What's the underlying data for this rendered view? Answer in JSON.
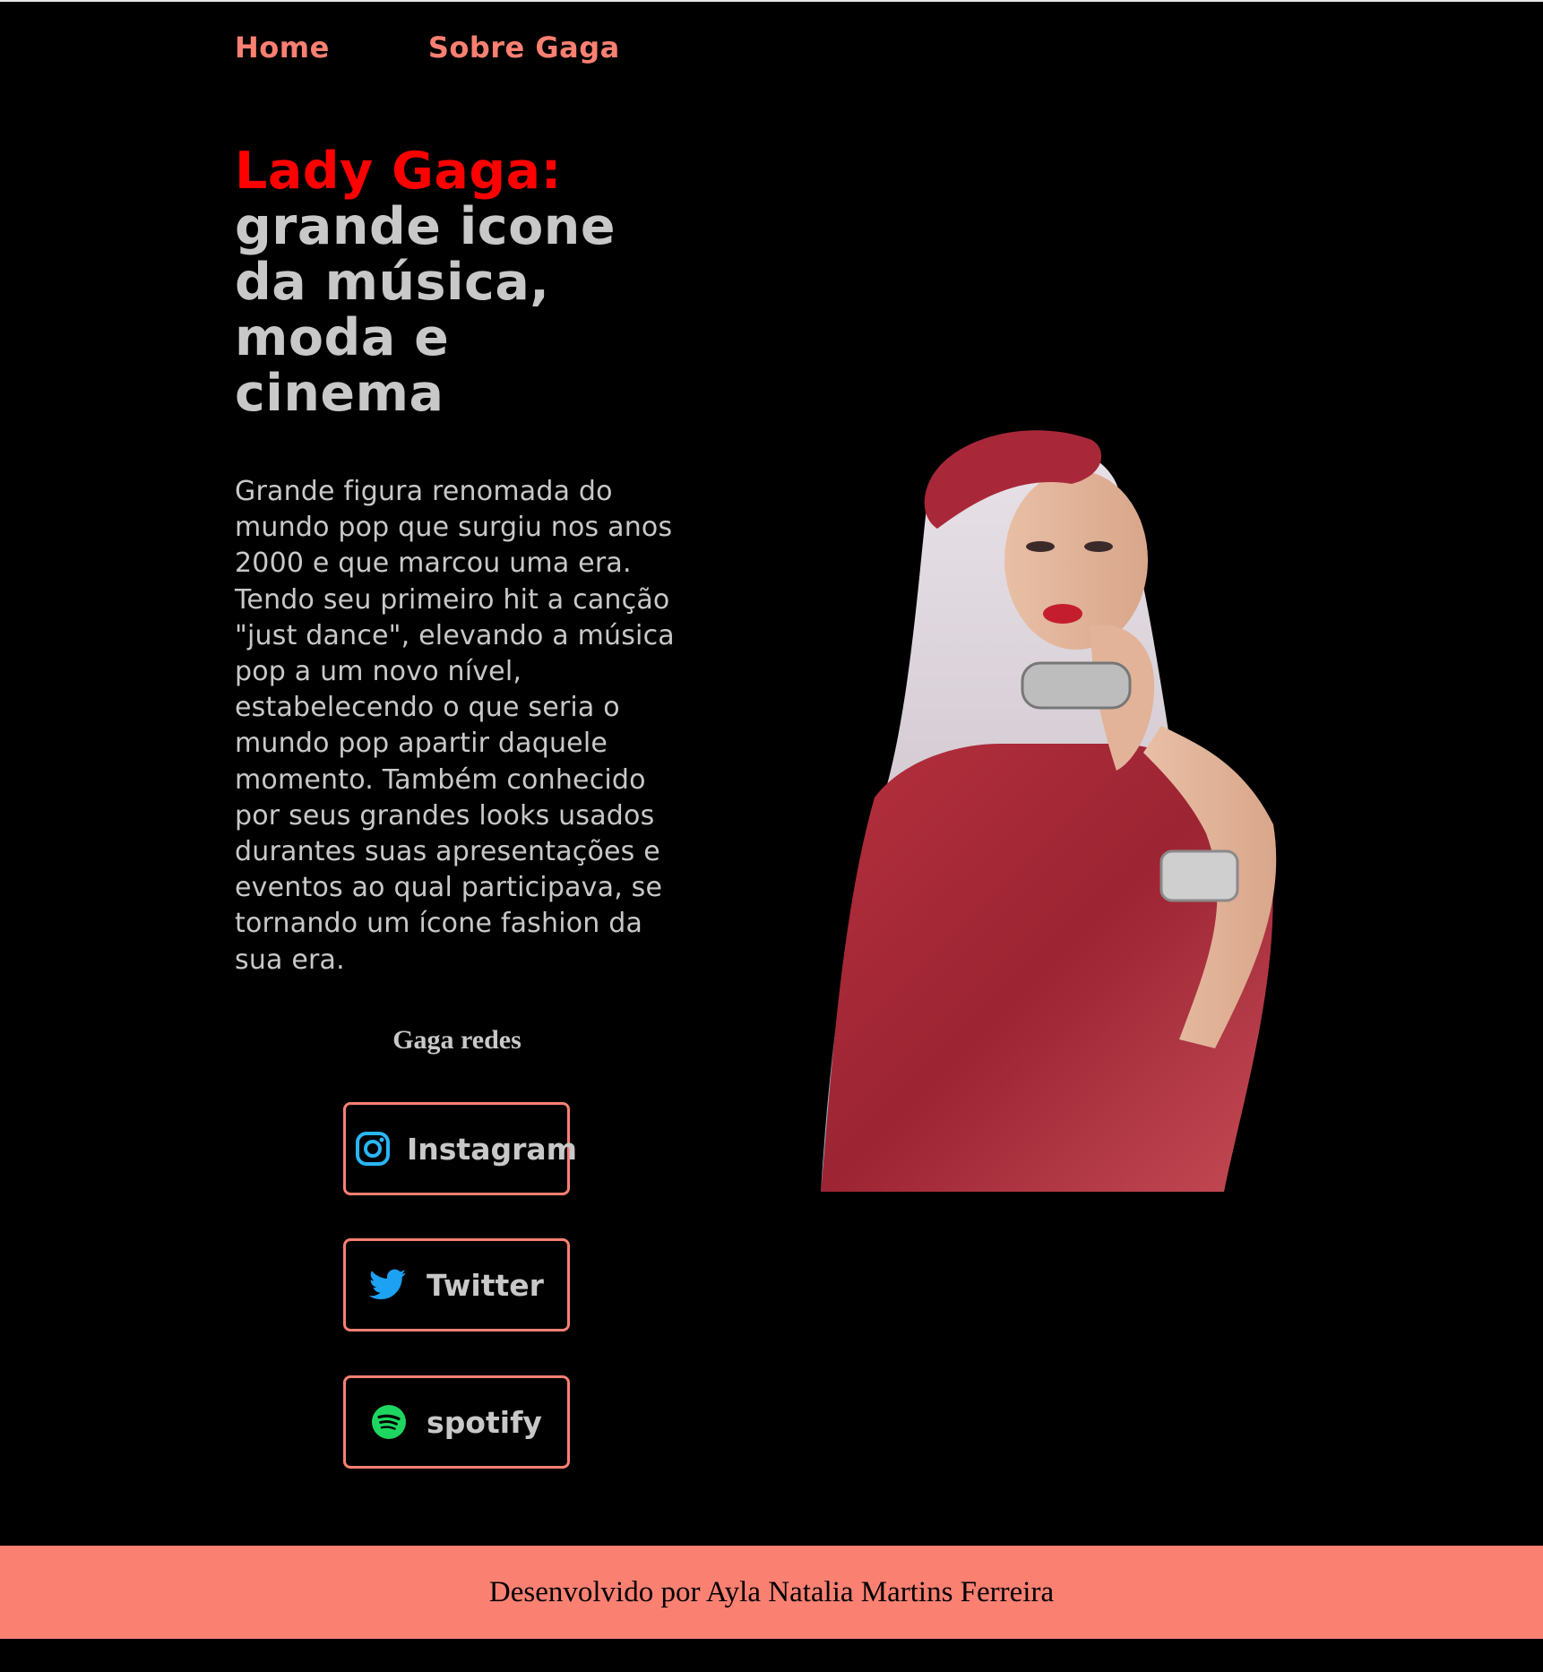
{
  "nav": {
    "home": "Home",
    "about": "Sobre Gaga"
  },
  "hero": {
    "title_name": "Lady Gaga:",
    "title_rest": "grande icone da música, moda e cinema",
    "description": "Grande figura renomada do mundo pop que surgiu nos anos 2000 e que marcou uma era. Tendo seu primeiro hit a canção \"just dance\", elevando a música pop a um novo nível, estabelecendo o que seria o mundo pop apartir daquele momento. Também conhecido por seus grandes looks usados durantes suas apresentações e eventos ao qual participava, se tornando um ícone fashion da sua era."
  },
  "social": {
    "heading": "Gaga redes",
    "instagram": "Instagram",
    "twitter": "Twitter",
    "spotify": "spotify"
  },
  "footer": {
    "text": "Desenvolvido por Ayla Natalia Martins Ferreira"
  },
  "colors": {
    "accent": "#fa8072",
    "title_red": "#ff0000",
    "text_gray": "#c8c8c8",
    "background": "#000000"
  }
}
